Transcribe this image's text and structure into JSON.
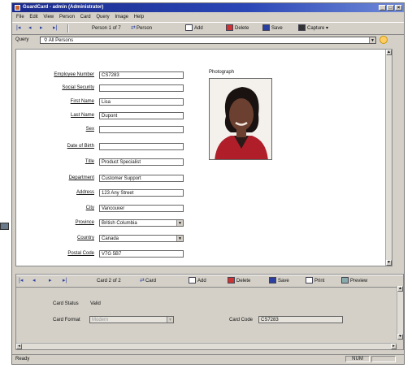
{
  "window": {
    "title": "GuardCard - admin (Administrator)"
  },
  "menu": [
    "File",
    "Edit",
    "View",
    "Person",
    "Card",
    "Query",
    "Image",
    "Help"
  ],
  "toolbar": {
    "record_position": "Person 1 of 7",
    "type_label": "Person",
    "add": "Add",
    "delete": "Delete",
    "save": "Save",
    "capture": "Capture"
  },
  "query": {
    "label": "Query",
    "value": "All Persons"
  },
  "person": {
    "fields": [
      {
        "label": "Employee Number",
        "value": "CS7283"
      },
      {
        "label": "Social Security",
        "value": ""
      },
      {
        "label": "First Name",
        "value": "Lisa"
      },
      {
        "label": "Last Name",
        "value": "Dupont"
      },
      {
        "label": "Sex",
        "value": ""
      },
      {
        "label": "Date of Birth",
        "value": ""
      },
      {
        "label": "Title",
        "value": "Product Specialist"
      },
      {
        "label": "Department",
        "value": "Customer Support"
      },
      {
        "label": "Address",
        "value": "123 Any Street"
      },
      {
        "label": "City",
        "value": "Vancouver"
      },
      {
        "label": "Province",
        "value": "British Columbia"
      },
      {
        "label": "Country",
        "value": "Canada"
      },
      {
        "label": "Postal Code",
        "value": "V7G 5B7"
      }
    ],
    "photo_label": "Photograph"
  },
  "card_toolbar": {
    "record_position": "Card 2 of 2",
    "type_label": "Card",
    "add": "Add",
    "delete": "Delete",
    "save": "Save",
    "print": "Print",
    "preview": "Preview"
  },
  "card": {
    "status_label": "Card Status",
    "status_value": "Valid",
    "format_label": "Card Format",
    "format_value": "Modern",
    "code_label": "Card Code",
    "code_value": "CS7283"
  },
  "statusbar": {
    "text": "Ready",
    "indicator": "NUM"
  },
  "colors": {
    "titlebar": "#1a2a8c",
    "face": "#d4d0c8",
    "field_bg": "#ffffff"
  }
}
